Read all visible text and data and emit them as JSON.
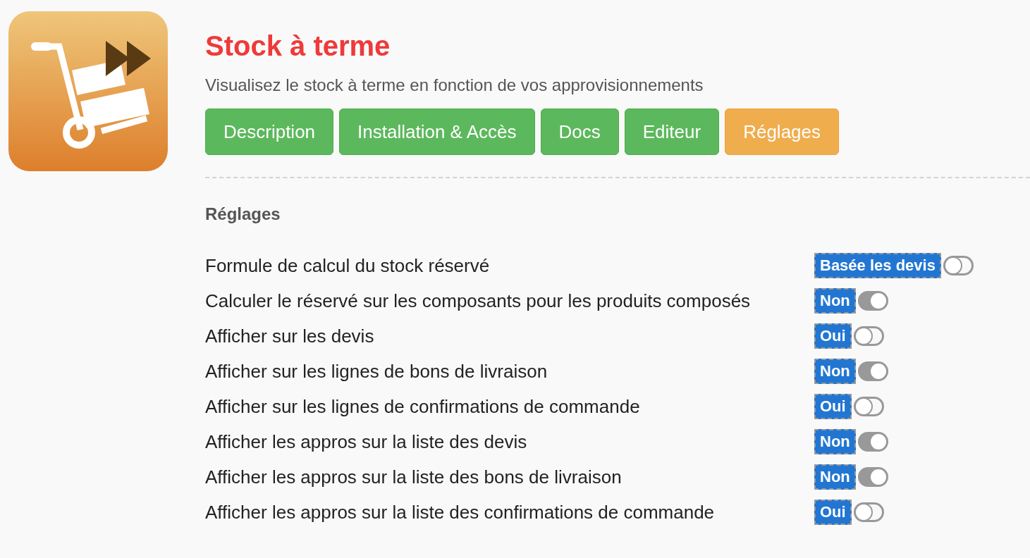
{
  "app": {
    "title": "Stock à terme",
    "subtitle": "Visualisez le stock à terme en fonction de vos approvisionnements"
  },
  "tabs": [
    {
      "label": "Description",
      "selected": false
    },
    {
      "label": "Installation & Accès",
      "selected": false
    },
    {
      "label": "Docs",
      "selected": false
    },
    {
      "label": "Editeur",
      "selected": false
    },
    {
      "label": "Réglages",
      "selected": true
    }
  ],
  "settings": {
    "heading": "Réglages",
    "rows": [
      {
        "label": "Formule de calcul du stock réservé",
        "value": "Basée les devis",
        "on": false
      },
      {
        "label": "Calculer le réservé sur les composants pour les produits composés",
        "value": "Non",
        "on": true
      },
      {
        "label": "Afficher sur les devis",
        "value": "Oui",
        "on": false
      },
      {
        "label": "Afficher sur les lignes de bons de livraison",
        "value": "Non",
        "on": true
      },
      {
        "label": "Afficher sur les lignes de confirmations de commande",
        "value": "Oui",
        "on": false
      },
      {
        "label": "Afficher les appros sur la liste des devis",
        "value": "Non",
        "on": true
      },
      {
        "label": "Afficher les appros sur la liste des bons de livraison",
        "value": "Non",
        "on": true
      },
      {
        "label": "Afficher les appros sur la liste des confirmations de commande",
        "value": "Oui",
        "on": false
      }
    ]
  }
}
